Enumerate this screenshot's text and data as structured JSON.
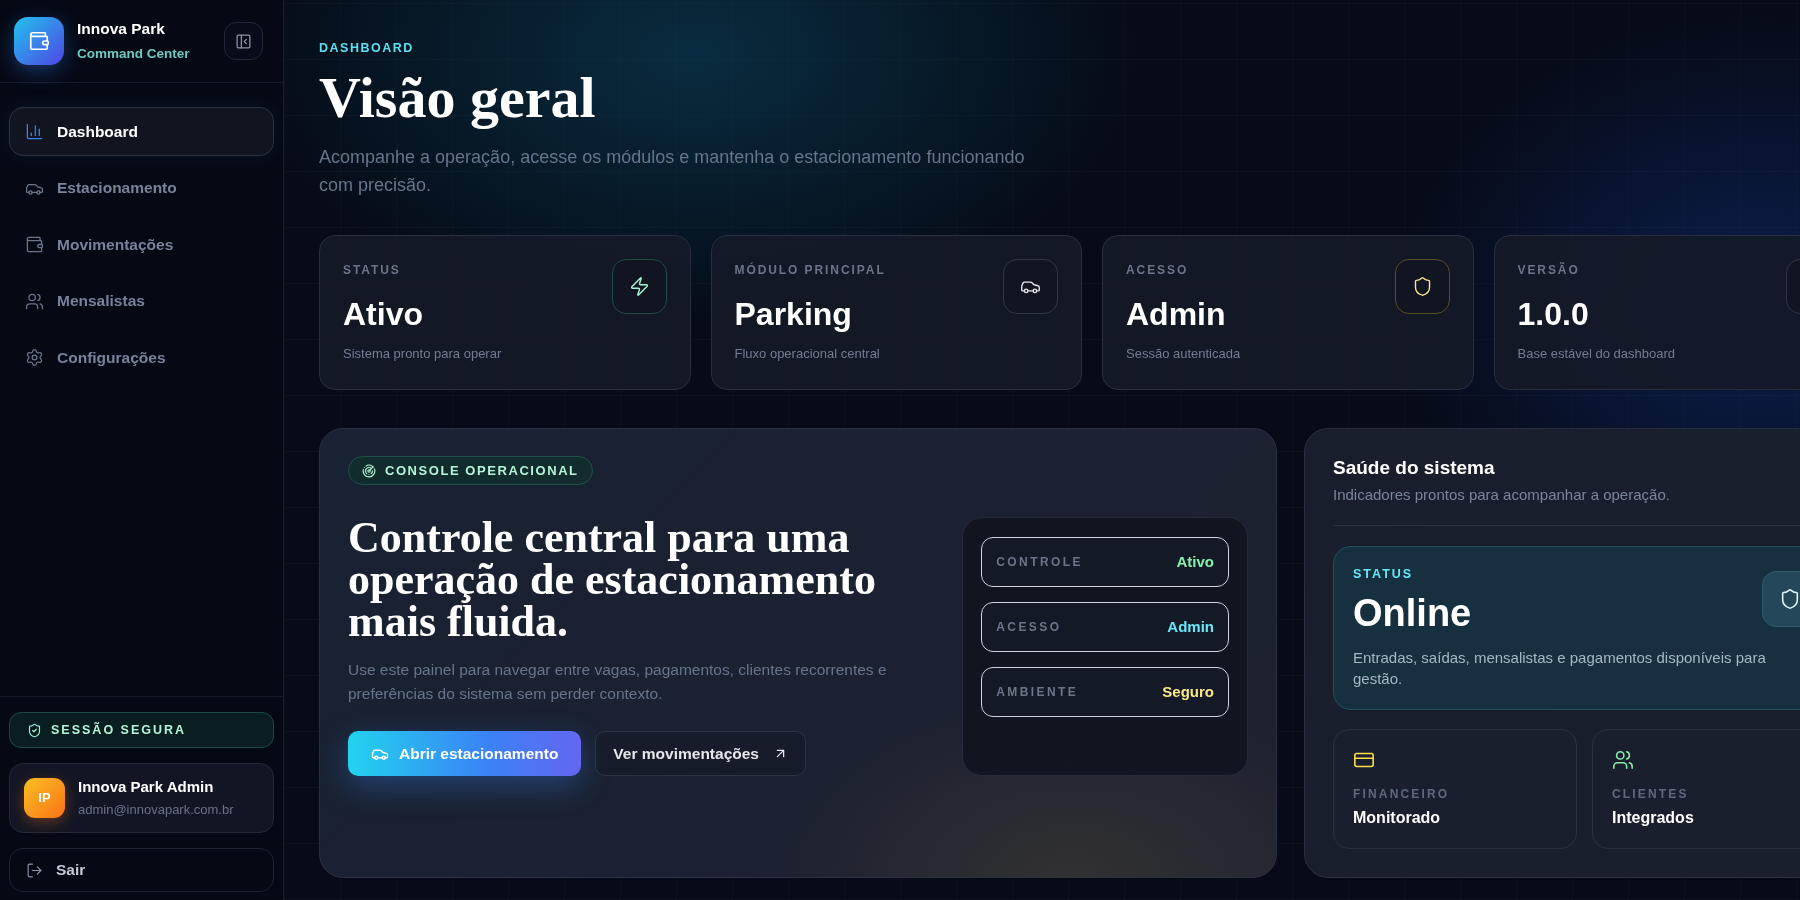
{
  "sidebar": {
    "brand": {
      "name": "Innova Park",
      "subtitle": "Command Center"
    },
    "nav_items": [
      {
        "label": "Dashboard",
        "selected": true
      },
      {
        "label": "Estacionamento",
        "selected": false
      },
      {
        "label": "Movimentações",
        "selected": false
      },
      {
        "label": "Mensalistas",
        "selected": false
      },
      {
        "label": "Configurações",
        "selected": false
      }
    ],
    "session_badge": "SESSÃO SEGURA",
    "user": {
      "initials": "IP",
      "name": "Innova Park Admin",
      "email": "admin@innovapark.com.br"
    },
    "logout_button": "Sair"
  },
  "header": {
    "eyebrow": "DASHBOARD",
    "title": "Visão geral",
    "subtitle": "Acompanhe a operação, acesse os módulos e mantenha o estacionamento funcionando com precisão."
  },
  "stat_cards": [
    {
      "label": "STATUS",
      "value": "Ativo",
      "description": "Sistema pronto para operar"
    },
    {
      "label": "MÓDULO PRINCIPAL",
      "value": "Parking",
      "description": "Fluxo operacional central"
    },
    {
      "label": "ACESSO",
      "value": "Admin",
      "description": "Sessão autenticada"
    },
    {
      "label": "VERSÃO",
      "value": "1.0.0",
      "description": "Base estável do dashboard"
    }
  ],
  "console": {
    "badge": "CONSOLE OPERACIONAL",
    "headline": "Controle central para uma operação de estacionamento mais fluida.",
    "text": "Use este painel para navegar entre vagas, pagamentos, clientes recorrentes e preferências do sistema sem perder contexto.",
    "primary_button": "Abrir estacionamento",
    "secondary_button": "Ver movimentações",
    "status_rows": [
      {
        "label": "CONTROLE",
        "value": "Ativo",
        "color": "#86efac"
      },
      {
        "label": "ACESSO",
        "value": "Admin",
        "color": "#67e8f9"
      },
      {
        "label": "AMBIENTE",
        "value": "Seguro",
        "color": "#fde68a"
      }
    ]
  },
  "system_health": {
    "title": "Saúde do sistema",
    "subtitle": "Indicadores prontos para acompanhar a operação.",
    "status_card": {
      "label": "STATUS",
      "value": "Online",
      "description": "Entradas, saídas, mensalistas e pagamentos disponíveis para gestão."
    },
    "metrics": [
      {
        "label": "FINANCEIRO",
        "value": "Monitorado",
        "color": "#fde047"
      },
      {
        "label": "CLIENTES",
        "value": "Integrados",
        "color": "#86efac"
      }
    ]
  }
}
